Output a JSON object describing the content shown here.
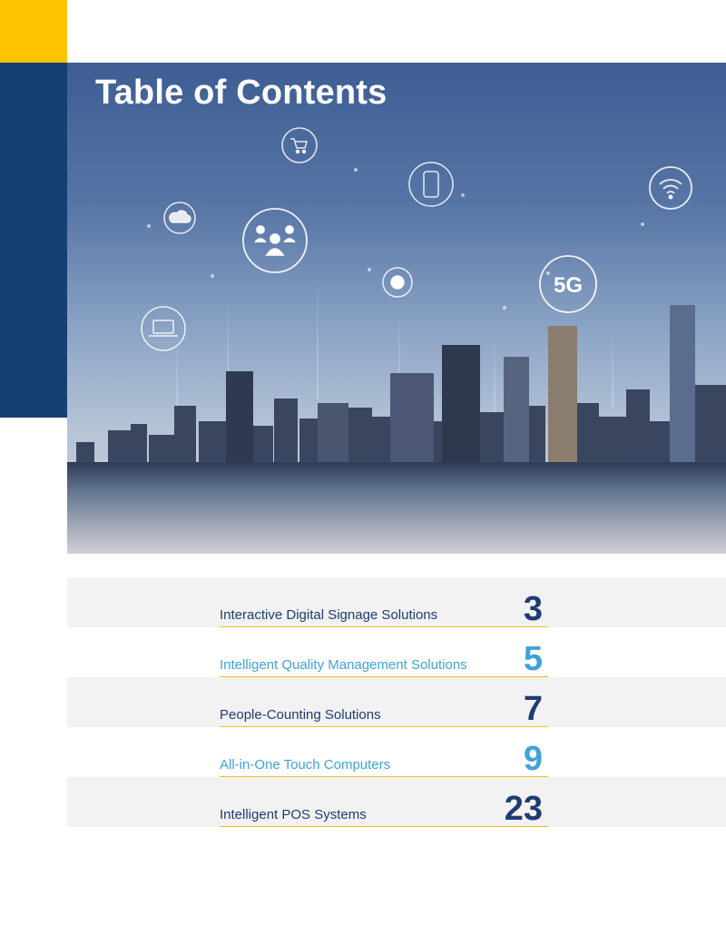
{
  "hero": {
    "title": "Table of Contents",
    "badge_5g": "5G",
    "icons": [
      "shopping-cart-icon",
      "smartphone-icon",
      "wifi-icon",
      "cloud-icon",
      "people-icon",
      "dot-icon",
      "laptop-icon",
      "5g-icon"
    ]
  },
  "toc": {
    "items": [
      {
        "label": "Interactive Digital Signage Solutions",
        "page": "3"
      },
      {
        "label": "Intelligent Quality Management Solutions",
        "page": "5"
      },
      {
        "label": "People-Counting Solutions",
        "page": "7"
      },
      {
        "label": "All-in-One Touch Computers",
        "page": "9"
      },
      {
        "label": "Intelligent POS Systems",
        "page": "23"
      }
    ]
  },
  "colors": {
    "accent_yellow": "#fdc300",
    "navy": "#163f74",
    "dark_text": "#1f3c72",
    "light_text": "#3fa3da",
    "rule": "#f0c020",
    "row_shade": "#f2f2f3"
  }
}
